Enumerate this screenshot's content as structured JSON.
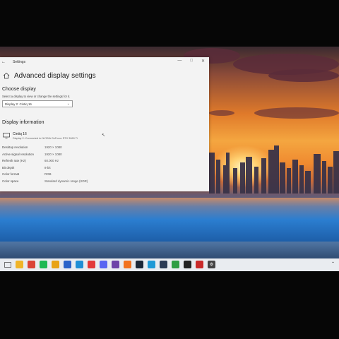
{
  "window": {
    "title": "Settings",
    "controls": {
      "minimize": "—",
      "maximize": "□",
      "close": "✕"
    },
    "back_glyph": "←"
  },
  "page": {
    "title": "Advanced display settings",
    "choose_display": {
      "heading": "Choose display",
      "hint": "Select a display to view or change the settings for it.",
      "selected": "Display 2: Cintiq 16"
    },
    "display_info": {
      "heading": "Display information",
      "display_name": "Cintiq 16",
      "display_sub": "Display 2: Connected to NVIDIA GeForce RTX 3060 Ti",
      "properties": [
        {
          "key": "Desktop resolution",
          "value": "1920 × 1080"
        },
        {
          "key": "Active signal resolution",
          "value": "1920 × 1080"
        },
        {
          "key": "Refresh rate (Hz)",
          "value": "60.000 Hz"
        },
        {
          "key": "Bit depth",
          "value": "8-bit"
        },
        {
          "key": "Color format",
          "value": "RGB"
        },
        {
          "key": "Color space",
          "value": "Standard dynamic range (SDR)"
        }
      ]
    }
  },
  "icons": {
    "home": "home-icon",
    "monitor": "monitor-icon",
    "chevron": "chevron-down-icon",
    "cursor": "mouse-cursor-icon"
  },
  "taskbar": {
    "apps": [
      {
        "name": "file-explorer",
        "color": "#f0b429",
        "glyph": ""
      },
      {
        "name": "chrome",
        "color": "#db4437",
        "glyph": ""
      },
      {
        "name": "spotify",
        "color": "#1db954",
        "glyph": ""
      },
      {
        "name": "folder",
        "color": "#e8a316",
        "glyph": ""
      },
      {
        "name": "app-blue",
        "color": "#2a63c9",
        "glyph": ""
      },
      {
        "name": "edge",
        "color": "#1f8fd6",
        "glyph": ""
      },
      {
        "name": "opera",
        "color": "#e23a3a",
        "glyph": ""
      },
      {
        "name": "discord",
        "color": "#5865f2",
        "glyph": ""
      },
      {
        "name": "krita",
        "color": "#6e44a8",
        "glyph": ""
      },
      {
        "name": "firefox",
        "color": "#f2731f",
        "glyph": ""
      },
      {
        "name": "steam",
        "color": "#1b2838",
        "glyph": ""
      },
      {
        "name": "battle-net",
        "color": "#1f9ad6",
        "glyph": ""
      },
      {
        "name": "monitor-app",
        "color": "#2b3b55",
        "glyph": ""
      },
      {
        "name": "green-app",
        "color": "#2f9e44",
        "glyph": ""
      },
      {
        "name": "dark-app",
        "color": "#222222",
        "glyph": ""
      },
      {
        "name": "red-app",
        "color": "#c92a2a",
        "glyph": ""
      },
      {
        "name": "settings",
        "color": "#444444",
        "glyph": "⚙"
      }
    ],
    "tray_glyph": "⌃"
  }
}
